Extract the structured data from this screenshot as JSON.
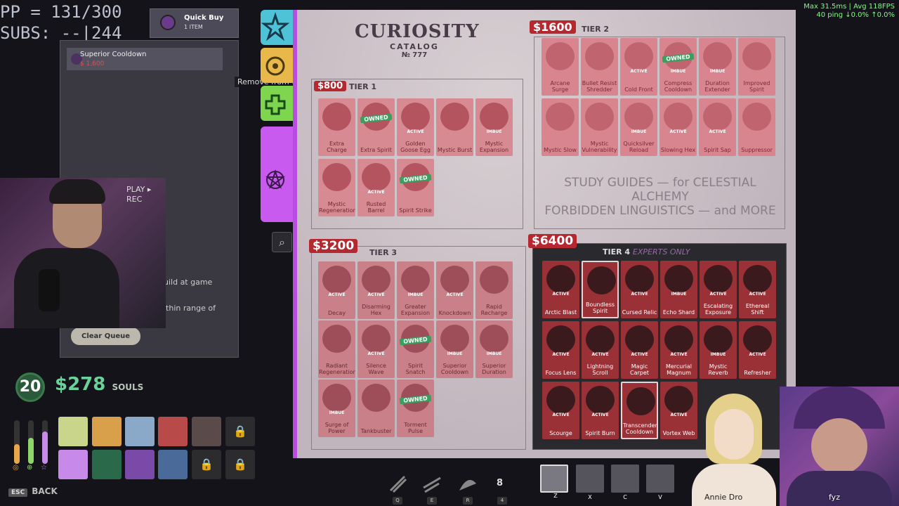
{
  "overlay": {
    "pp": "PP = 131/300",
    "subs": "SUBS: --|244"
  },
  "perf": {
    "line1": "Max 31.5ms | Avg 118FPS",
    "line2": "40 ping ↓0.0% ↑0.0%"
  },
  "quick_buy": {
    "title": "Quick Buy",
    "count": "1 ITEM"
  },
  "queue": {
    "item_name": "Superior Cooldown",
    "item_price": "$ 1,600",
    "hint1": "uild at game",
    "hint2": "ithin range of",
    "clear_label": "Clear Queue",
    "remove_tooltip": "Remove from Queue"
  },
  "webcam": {
    "overlay_text": "PLAY ▸\nREC"
  },
  "catalog": {
    "title": "CURIOSITY",
    "subtitle": "CATALOG",
    "number": "№ 777",
    "study_line1": "STUDY GUIDES — for CELESTIAL ALCHEMY",
    "study_line2": "FORBIDDEN LINGUISTICS — and MORE",
    "tiers": [
      {
        "label": "TIER 1",
        "price": "$800",
        "expert": ""
      },
      {
        "label": "TIER 2",
        "price": "$1600",
        "expert": ""
      },
      {
        "label": "TIER 3",
        "price": "$3200",
        "expert": ""
      },
      {
        "label": "TIER 4",
        "price": "$6400",
        "expert": "EXPERTS ONLY"
      }
    ],
    "tier1": [
      {
        "name": "Extra Charge",
        "status": "",
        "owned": false
      },
      {
        "name": "Extra Spirit",
        "status": "",
        "owned": true
      },
      {
        "name": "Golden Goose Egg",
        "status": "ACTIVE",
        "owned": false
      },
      {
        "name": "Mystic Burst",
        "status": "",
        "owned": false
      },
      {
        "name": "Mystic Expansion",
        "status": "IMBUE",
        "owned": false
      },
      {
        "name": "Mystic Regeneration",
        "status": "",
        "owned": false
      },
      {
        "name": "Rusted Barrel",
        "status": "ACTIVE",
        "owned": false
      },
      {
        "name": "Spirit Strike",
        "status": "",
        "owned": true
      }
    ],
    "tier2": [
      {
        "name": "Arcane Surge",
        "status": "",
        "owned": false
      },
      {
        "name": "Bullet Resist Shredder",
        "status": "",
        "owned": false
      },
      {
        "name": "Cold Front",
        "status": "ACTIVE",
        "owned": false
      },
      {
        "name": "Compress Cooldown",
        "status": "IMBUE",
        "owned": true
      },
      {
        "name": "Duration Extender",
        "status": "IMBUE",
        "owned": false
      },
      {
        "name": "Improved Spirit",
        "status": "",
        "owned": false
      },
      {
        "name": "Mystic Slow",
        "status": "",
        "owned": false
      },
      {
        "name": "Mystic Vulnerability",
        "status": "",
        "owned": false
      },
      {
        "name": "Quicksilver Reload",
        "status": "IMBUE",
        "owned": false
      },
      {
        "name": "Slowing Hex",
        "status": "ACTIVE",
        "owned": false
      },
      {
        "name": "Spirit Sap",
        "status": "ACTIVE",
        "owned": false
      },
      {
        "name": "Suppressor",
        "status": "",
        "owned": false
      }
    ],
    "tier3": [
      {
        "name": "Decay",
        "status": "ACTIVE",
        "owned": false
      },
      {
        "name": "Disarming Hex",
        "status": "ACTIVE",
        "owned": false
      },
      {
        "name": "Greater Expansion",
        "status": "IMBUE",
        "owned": false
      },
      {
        "name": "Knockdown",
        "status": "ACTIVE",
        "owned": false
      },
      {
        "name": "Rapid Recharge",
        "status": "",
        "owned": false
      },
      {
        "name": "Radiant Regeneration",
        "status": "",
        "owned": false
      },
      {
        "name": "Silence Wave",
        "status": "ACTIVE",
        "owned": false
      },
      {
        "name": "Spirit Snatch",
        "status": "",
        "owned": true
      },
      {
        "name": "Superior Cooldown",
        "status": "IMBUE",
        "owned": false
      },
      {
        "name": "Superior Duration",
        "status": "IMBUE",
        "owned": false
      },
      {
        "name": "Surge of Power",
        "status": "IMBUE",
        "owned": false
      },
      {
        "name": "Tankbuster",
        "status": "",
        "owned": false
      },
      {
        "name": "Torment Pulse",
        "status": "",
        "owned": true
      }
    ],
    "tier4": [
      {
        "name": "Arctic Blast",
        "status": "ACTIVE",
        "owned": false
      },
      {
        "name": "Boundless Spirit",
        "status": "",
        "owned": false
      },
      {
        "name": "Cursed Relic",
        "status": "ACTIVE",
        "owned": false
      },
      {
        "name": "Echo Shard",
        "status": "IMBUE",
        "owned": false
      },
      {
        "name": "Escalating Exposure",
        "status": "ACTIVE",
        "owned": false
      },
      {
        "name": "Ethereal Shift",
        "status": "ACTIVE",
        "owned": false
      },
      {
        "name": "Focus Lens",
        "status": "ACTIVE",
        "owned": false
      },
      {
        "name": "Lightning Scroll",
        "status": "ACTIVE",
        "owned": false
      },
      {
        "name": "Magic Carpet",
        "status": "ACTIVE",
        "owned": false
      },
      {
        "name": "Mercurial Magnum",
        "status": "ACTIVE",
        "owned": false
      },
      {
        "name": "Mystic Reverb",
        "status": "IMBUE",
        "owned": false
      },
      {
        "name": "Refresher",
        "status": "ACTIVE",
        "owned": false
      },
      {
        "name": "Scourge",
        "status": "ACTIVE",
        "owned": false
      },
      {
        "name": "Spirit Burn",
        "status": "ACTIVE",
        "owned": false
      },
      {
        "name": "Transcendent Cooldown",
        "status": "",
        "owned": false
      },
      {
        "name": "Vortex Web",
        "status": "ACTIVE",
        "owned": false
      }
    ]
  },
  "hud": {
    "level": "20",
    "souls": "$278",
    "souls_label": "SOULS",
    "back_key": "ESC",
    "back_label": "BACK"
  },
  "hotbar": {
    "keys": [
      "Q",
      "E",
      "R",
      "4"
    ],
    "charges": "8",
    "quick_keys": [
      "Z",
      "X",
      "C",
      "V"
    ]
  },
  "streamers": {
    "left": "Annie Dro",
    "right": "fyz"
  },
  "colors": {
    "accent": "#b94de2",
    "price": "#b6282f",
    "souls": "#6bd19a"
  }
}
